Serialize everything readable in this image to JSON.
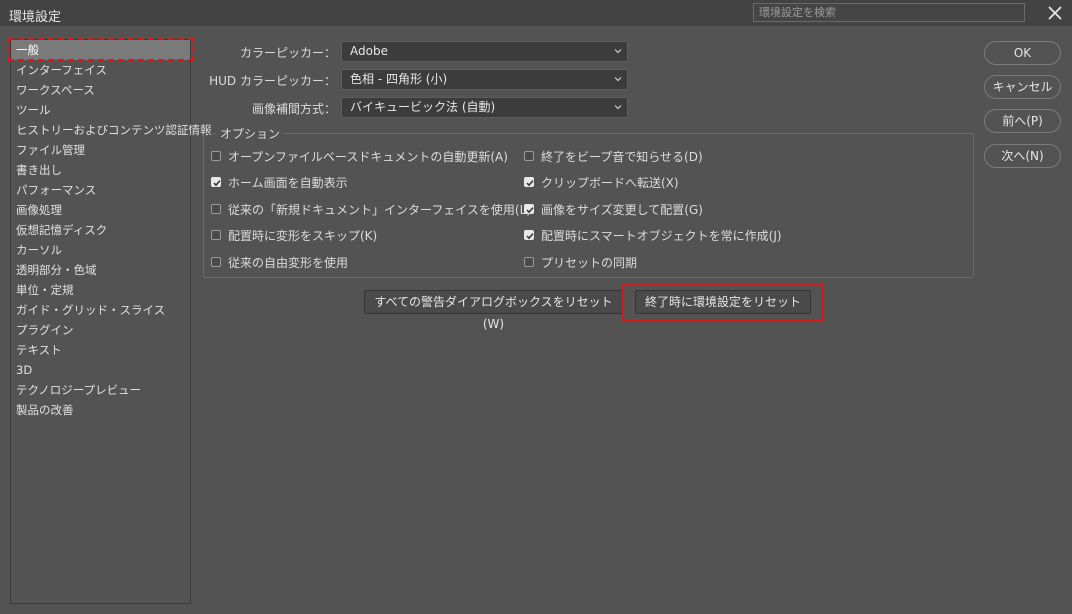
{
  "window": {
    "title": "環境設定"
  },
  "search": {
    "placeholder": "環境設定を検索"
  },
  "sidebar": {
    "items": [
      {
        "label": "一般",
        "selected": true
      },
      {
        "label": "インターフェイス"
      },
      {
        "label": "ワークスペース"
      },
      {
        "label": "ツール"
      },
      {
        "label": "ヒストリーおよびコンテンツ認証情報"
      },
      {
        "label": "ファイル管理"
      },
      {
        "label": "書き出し"
      },
      {
        "label": "パフォーマンス"
      },
      {
        "label": "画像処理"
      },
      {
        "label": "仮想記憶ディスク"
      },
      {
        "label": "カーソル"
      },
      {
        "label": "透明部分・色域"
      },
      {
        "label": "単位・定規"
      },
      {
        "label": "ガイド・グリッド・スライス"
      },
      {
        "label": "プラグイン"
      },
      {
        "label": "テキスト"
      },
      {
        "label": "3D"
      },
      {
        "label": "テクノロジープレビュー"
      },
      {
        "label": "製品の改善"
      }
    ]
  },
  "settings": {
    "color_picker": {
      "label": "カラーピッカー：",
      "value": "Adobe"
    },
    "hud_color_picker": {
      "label": "HUD カラーピッカー：",
      "value": "色相 - 四角形 (小)"
    },
    "interpolation": {
      "label": "画像補間方式：",
      "value": "バイキュービック法 (自動)"
    }
  },
  "options": {
    "legend": "オプション",
    "left": [
      {
        "label": "オープンファイルベースドキュメントの自動更新(A)",
        "checked": false
      },
      {
        "label": "ホーム画面を自動表示",
        "checked": true
      },
      {
        "label": "従来の「新規ドキュメント」インターフェイスを使用(L)",
        "checked": false
      },
      {
        "label": "配置時に変形をスキップ(K)",
        "checked": false
      },
      {
        "label": "従来の自由変形を使用",
        "checked": false
      }
    ],
    "right": [
      {
        "label": "終了をビープ音で知らせる(D)",
        "checked": false
      },
      {
        "label": "クリップボードへ転送(X)",
        "checked": true
      },
      {
        "label": "画像をサイズ変更して配置(G)",
        "checked": true
      },
      {
        "label": "配置時にスマートオブジェクトを常に作成(J)",
        "checked": true
      },
      {
        "label": "プリセットの同期",
        "checked": false
      }
    ]
  },
  "reset": {
    "warnings_label": "すべての警告ダイアログボックスをリセット (W)",
    "prefs_label": "終了時に環境設定をリセット"
  },
  "buttons": {
    "ok": "OK",
    "cancel": "キャンセル",
    "prev": "前へ(P)",
    "next": "次へ(N)"
  },
  "colors": {
    "background": "#535353",
    "highlight": "#d01c1c"
  }
}
